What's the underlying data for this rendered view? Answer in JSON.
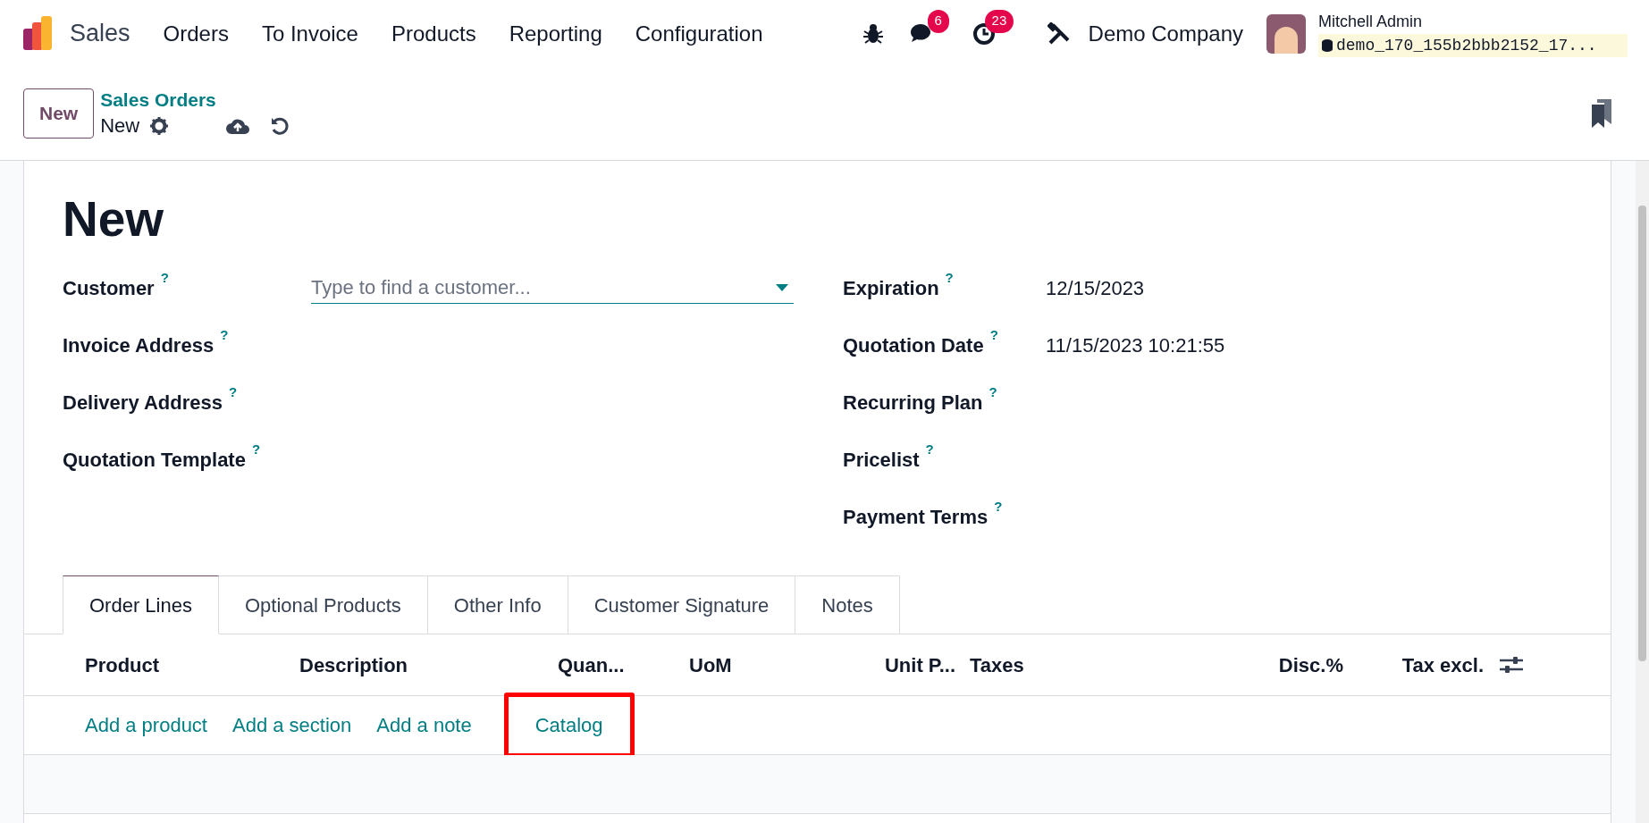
{
  "navbar": {
    "app_name": "Sales",
    "menu": [
      "Orders",
      "To Invoice",
      "Products",
      "Reporting",
      "Configuration"
    ],
    "chat_count": "6",
    "activity_count": "23",
    "company": "Demo Company",
    "user_name": "Mitchell Admin",
    "database": "demo_170_155b2bbb2152_17..."
  },
  "control_panel": {
    "new_button": "New",
    "breadcrumb": "Sales Orders",
    "current": "New"
  },
  "form": {
    "title": "New",
    "left_fields": [
      {
        "label": "Customer",
        "help": "?",
        "kind": "dropdown",
        "placeholder": "Type to find a customer..."
      },
      {
        "label": "Invoice Address",
        "help": "?",
        "kind": "text"
      },
      {
        "label": "Delivery Address",
        "help": "?",
        "kind": "text"
      },
      {
        "label": "Quotation Template",
        "help": "?",
        "kind": "text"
      }
    ],
    "right_fields": [
      {
        "label": "Expiration",
        "help": "?",
        "kind": "text",
        "value": "12/15/2023"
      },
      {
        "label": "Quotation Date",
        "help": "?",
        "kind": "text",
        "value": "11/15/2023 10:21:55"
      },
      {
        "label": "Recurring Plan",
        "help": "?",
        "kind": "text"
      },
      {
        "label": "Pricelist",
        "help": "?",
        "kind": "text"
      },
      {
        "label": "Payment Terms",
        "help": "?",
        "kind": "text"
      }
    ]
  },
  "tabs": [
    {
      "label": "Order Lines",
      "selected": true
    },
    {
      "label": "Optional Products",
      "selected": false
    },
    {
      "label": "Other Info",
      "selected": false
    },
    {
      "label": "Customer Signature",
      "selected": false
    },
    {
      "label": "Notes",
      "selected": false
    }
  ],
  "table": {
    "columns": [
      {
        "label": "Product"
      },
      {
        "label": "Description"
      },
      {
        "label": "Quan..."
      },
      {
        "label": "UoM"
      },
      {
        "label": "Unit P..."
      },
      {
        "label": "Taxes"
      },
      {
        "label": "Disc.%"
      },
      {
        "label": "Tax excl."
      }
    ],
    "actions": [
      {
        "label": "Add a product",
        "highlighted": false
      },
      {
        "label": "Add a section",
        "highlighted": false
      },
      {
        "label": "Add a note",
        "highlighted": false
      },
      {
        "label": "Catalog",
        "highlighted": true
      }
    ]
  }
}
